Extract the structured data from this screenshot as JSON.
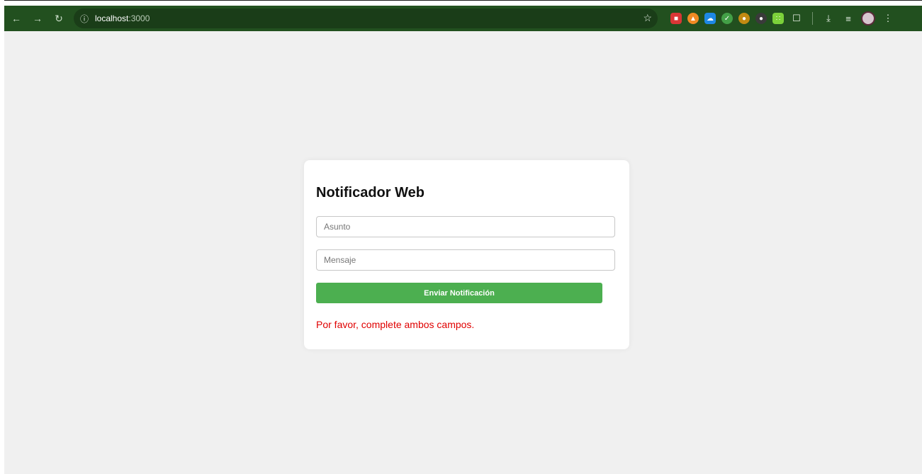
{
  "browser": {
    "url_host": "localhost",
    "url_port": ":3000",
    "nav": {
      "back_icon": "arrow-left-icon",
      "forward_icon": "arrow-right-icon",
      "reload_icon": "reload-icon"
    },
    "colors": {
      "toolbar": "#22501f",
      "omnibox": "#1a3d18"
    }
  },
  "form": {
    "title": "Notificador Web",
    "subject_placeholder": "Asunto",
    "subject_value": "",
    "message_placeholder": "Mensaje",
    "message_value": "",
    "submit_label": "Enviar Notificación",
    "error_text": "Por favor, complete ambos campos.",
    "colors": {
      "button": "#4caf50",
      "error": "#e00000"
    }
  }
}
